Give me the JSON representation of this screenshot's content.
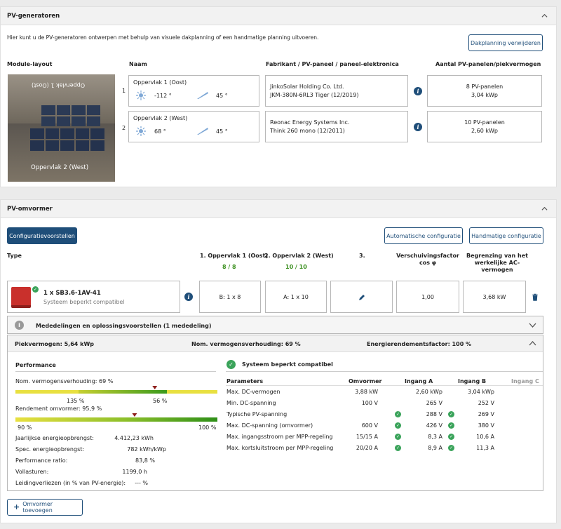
{
  "pv_generators": {
    "title": "PV-generatoren",
    "intro": "Hier kunt u de PV-generatoren ontwerpen met behulp van visuele dakplanning of een handmatige planning uitvoeren.",
    "remove_button": "Dakplanning verwijderen",
    "headers": {
      "layout": "Module-layout",
      "name": "Naam",
      "manufacturer": "Fabrikant / PV-paneel / paneel-elektronica",
      "count": "Aantal PV-panelen/piekvermogen"
    },
    "roof_label_top": "Oppervlak 1 (Oost)",
    "roof_label_bottom": "Oppervlak 2 (West)",
    "rows": [
      {
        "index": "1",
        "name": "Oppervlak 1 (Oost)",
        "azimuth": "-112 °",
        "tilt": "45 °",
        "manufacturer": "JinkoSolar Holding Co. Ltd.",
        "panel": "JKM-380N-6RL3 Tiger (12/2019)",
        "panels": "8 PV-panelen",
        "power": "3,04 kWp"
      },
      {
        "index": "2",
        "name": "Oppervlak 2 (West)",
        "azimuth": "68 °",
        "tilt": "45 °",
        "manufacturer": "Reonac Energy Systems Inc.",
        "panel": "Think 260 mono (12/2011)",
        "panels": "10 PV-panelen",
        "power": "2,60 kWp"
      }
    ]
  },
  "inverter": {
    "title": "PV-omvormer",
    "config_suggestions": "Configuratievoorstellen",
    "auto_config": "Automatische configuratie",
    "manual_config": "Handmatige configuratie",
    "col_type": "Type",
    "col_surface1": "1. Oppervlak 1 (Oost)",
    "col_surface1_val": "8 / 8",
    "col_surface2": "2. Oppervlak 2 (West)",
    "col_surface2_val": "10 / 10",
    "col_3": "3.",
    "col_shift": "Verschuivingsfactor cos φ",
    "col_limit": "Begrenzing van het werkelijke AC-vermogen",
    "device_name": "1 x SB3.6-1AV-41",
    "device_status": "Systeem beperkt compatibel",
    "cell_b": "B: 1 x 8",
    "cell_a": "A: 1 x 10",
    "cell_cos": "1,00",
    "cell_limit": "3,68 kW",
    "messages": "Mededelingen en oplossingsvoorstellen (1 mededeling)",
    "peak": "Piekvermogen: 5,64 kWp",
    "ratio": "Nom. vermogensverhouding: 69 %",
    "energy_factor": "Energierendementsfactor: 100 %",
    "performance_title": "Performance",
    "nom_ratio_label": "Nom. vermogensverhouding: 69 %",
    "nom_ratio_left": "135 %",
    "nom_ratio_right": "56 %",
    "nom_ratio_marker": 0.69,
    "efficiency_label": "Rendement omvormer: 95,9 %",
    "eff_left": "90 %",
    "eff_right": "100 %",
    "eff_marker": 0.59,
    "stats": [
      {
        "label": "Jaarlijkse energieopbrengst:",
        "value": "4.412,23 kWh"
      },
      {
        "label": "Spec. energieopbrengst:",
        "value": "782 kWh/kWp"
      },
      {
        "label": "Performance ratio:",
        "value": "83,8 %"
      },
      {
        "label": "Vollasturen:",
        "value": "1199,0 h"
      },
      {
        "label": "Leidingverliezen (in % van PV-energie):",
        "value": "--- %"
      }
    ],
    "compat_title": "Systeem beperkt compatibel",
    "table_headers": {
      "param": "Parameters",
      "inv": "Omvormer",
      "a": "Ingang A",
      "b": "Ingang B",
      "c": "Ingang C"
    },
    "params": [
      {
        "name": "Max. DC-vermogen",
        "inv": "3,88 kW",
        "a": "2,60 kWp",
        "b": "3,04 kWp",
        "check": false
      },
      {
        "name": "Min. DC-spanning",
        "inv": "100 V",
        "a": "265 V",
        "b": "252 V",
        "check": false
      },
      {
        "name": "Typische PV-spanning",
        "inv": "",
        "a": "288 V",
        "b": "269 V",
        "check": true
      },
      {
        "name": "Max. DC-spanning (omvormer)",
        "inv": "600 V",
        "a": "426 V",
        "b": "380 V",
        "check": true
      },
      {
        "name": "Max. ingangsstroom per MPP-regeling",
        "inv": "15/15 A",
        "a": "8,3 A",
        "b": "10,6 A",
        "check": true
      },
      {
        "name": "Max. kortsluitstroom per MPP-regeling",
        "inv": "20/20 A",
        "a": "8,9 A",
        "b": "11,3 A",
        "check": true
      }
    ],
    "add_inverter": "Omvormer toevoegen"
  },
  "colors": {
    "brand": "#1f4e79",
    "ok": "#3aa35a",
    "val_green": "#3a8f1e"
  }
}
